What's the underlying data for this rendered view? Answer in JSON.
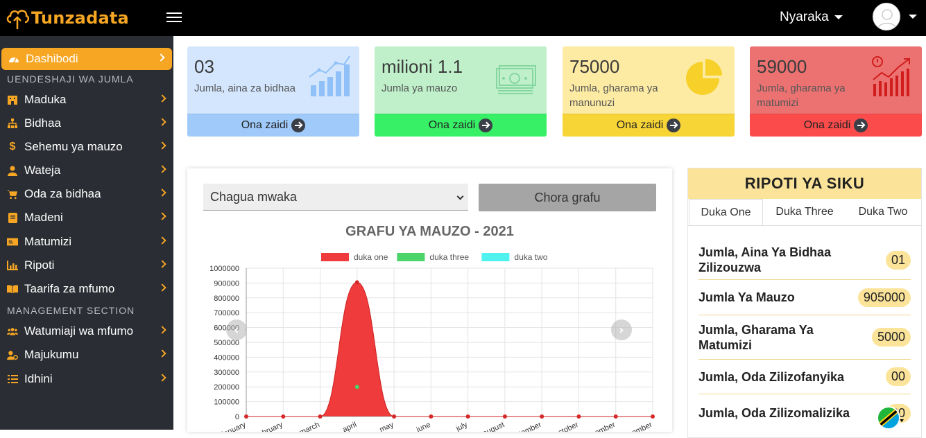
{
  "brand": {
    "name": "Tunzadata"
  },
  "header": {
    "docs_label": "Nyaraka"
  },
  "sidebar": {
    "items": [
      {
        "label": "Dashibodi",
        "icon": "dashboard-icon",
        "active": true
      },
      {
        "label": "Maduka",
        "icon": "store-icon"
      },
      {
        "label": "Bidhaa",
        "icon": "sitemap-icon"
      },
      {
        "label": "Sehemu ya mauzo",
        "icon": "dollar-icon"
      },
      {
        "label": "Wateja",
        "icon": "user-icon"
      },
      {
        "label": "Oda za bidhaa",
        "icon": "cart-icon"
      },
      {
        "label": "Madeni",
        "icon": "book-icon"
      },
      {
        "label": "Matumizi",
        "icon": "money-icon"
      },
      {
        "label": "Ripoti",
        "icon": "chart-icon"
      },
      {
        "label": "Taarifa za mfumo",
        "icon": "open-book-icon"
      },
      {
        "label": "Watumiaji wa mfumo",
        "icon": "users-icon"
      },
      {
        "label": "Majukumu",
        "icon": "user-gear-icon"
      },
      {
        "label": "Idhini",
        "icon": "list-check-icon"
      }
    ],
    "sections": [
      "UENDESHAJI WA JUMLA",
      "MANAGEMENT SECTION"
    ]
  },
  "cards": [
    {
      "value": "03",
      "label": "Jumla, aina za bidhaa",
      "footer": "Ona zaidi",
      "bg": "#d3e6fd",
      "foot_bg": "#9fcaf9",
      "icon": "bar-growth-icon"
    },
    {
      "value": "milioni 1.1",
      "label": "Jumla ya mauzo",
      "footer": "Ona zaidi",
      "bg": "#bff0ca",
      "foot_bg": "#37f066",
      "icon": "cash-icon"
    },
    {
      "value": "75000",
      "label": "Jumla, gharama ya manunuzi",
      "footer": "Ona zaidi",
      "bg": "#fdeba3",
      "foot_bg": "#f8d536",
      "icon": "pie-icon"
    },
    {
      "value": "59000",
      "label": "Jumla, gharama ya matumizi",
      "footer": "Ona zaidi",
      "bg": "#ec7272",
      "foot_bg": "#fb4b4b",
      "icon": "expense-chart-icon"
    }
  ],
  "chart_panel": {
    "select_value": "Chagua mwaka",
    "draw_button": "Chora grafu"
  },
  "chart_data": {
    "type": "area",
    "title": "GRAFU YA MAUZO - 2021",
    "categories": [
      "january",
      "february",
      "march",
      "april",
      "may",
      "june",
      "july",
      "august",
      "september",
      "october",
      "november",
      "december"
    ],
    "ylim": [
      0,
      1000000
    ],
    "yticks": [
      0,
      100000,
      200000,
      300000,
      400000,
      500000,
      600000,
      700000,
      800000,
      900000,
      1000000
    ],
    "series": [
      {
        "name": "duka one",
        "color": "#ef3b3b",
        "values": [
          0,
          0,
          0,
          905000,
          0,
          0,
          0,
          0,
          0,
          0,
          0,
          0
        ]
      },
      {
        "name": "duka three",
        "color": "#4cd46a",
        "values": [
          0,
          0,
          0,
          200000,
          0,
          0,
          0,
          0,
          0,
          0,
          0,
          0
        ]
      },
      {
        "name": "duka two",
        "color": "#4ff2ef",
        "values": [
          0,
          0,
          0,
          0,
          0,
          0,
          0,
          0,
          0,
          0,
          0,
          0
        ]
      }
    ],
    "legend": "top",
    "grid": true
  },
  "report": {
    "title": "RIPOTI YA SIKU",
    "tabs": [
      "Duka One",
      "Duka Three",
      "Duka Two"
    ],
    "rows": [
      {
        "label": "Jumla, Aina Ya Bidhaa Zilizouzwa",
        "value": "01"
      },
      {
        "label": "Jumla Ya Mauzo",
        "value": "905000"
      },
      {
        "label": "Jumla, Gharama Ya Matumizi",
        "value": "5000"
      },
      {
        "label": "Jumla, Oda Zilizofanyika",
        "value": "00"
      },
      {
        "label": "Jumla, Oda Zilizomalizika",
        "value": "00"
      }
    ]
  }
}
